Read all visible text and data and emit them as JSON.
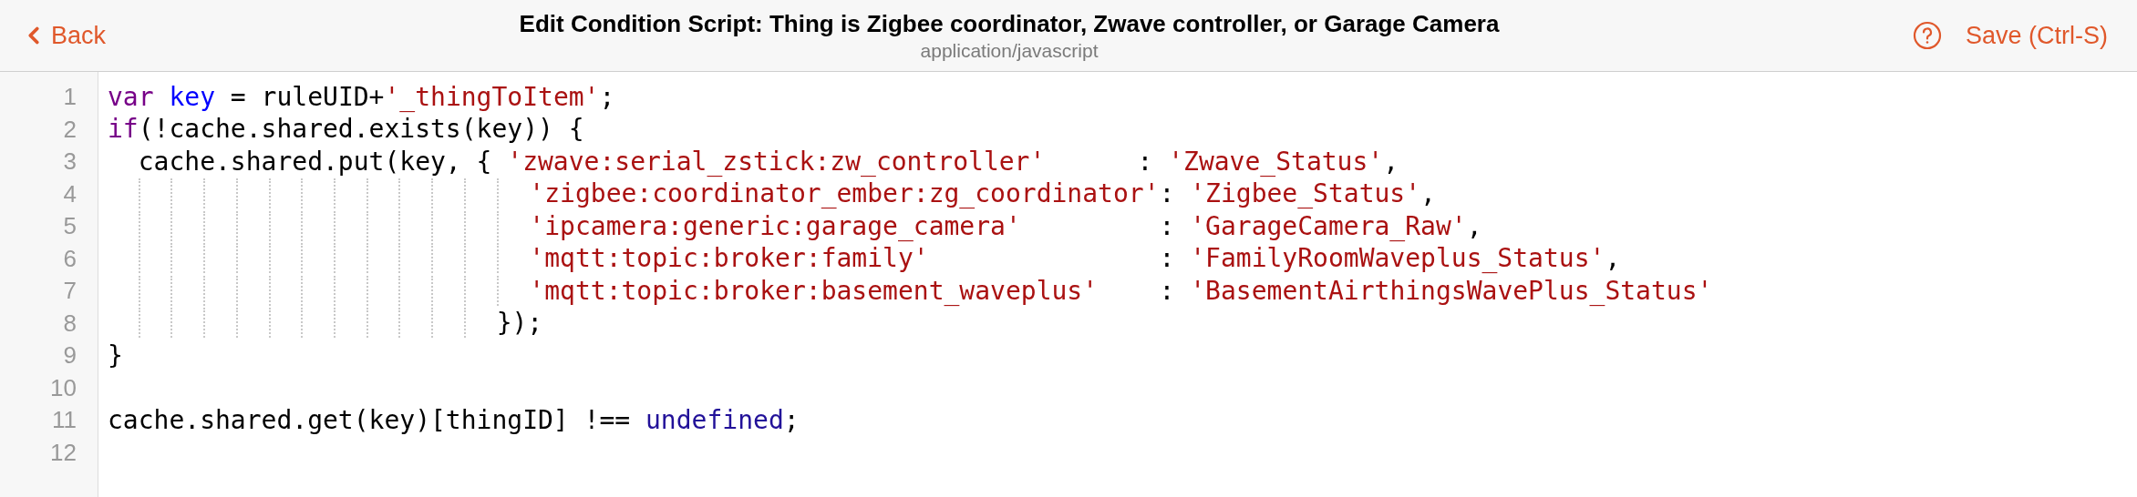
{
  "header": {
    "back": "Back",
    "title": "Edit Condition Script: Thing is Zigbee coordinator, Zwave controller, or Garage Camera",
    "subtitle": "application/javascript",
    "save": "Save (Ctrl-S)"
  },
  "editor": {
    "lines": [
      {
        "number": "1",
        "tokens": [
          {
            "kind": "keyword",
            "text": "var"
          },
          {
            "kind": "def",
            "text": " key"
          },
          {
            "kind": "plain",
            "text": " = ruleUID+"
          },
          {
            "kind": "string",
            "text": "'_thingToItem'"
          },
          {
            "kind": "plain",
            "text": ";"
          }
        ]
      },
      {
        "number": "2",
        "tokens": [
          {
            "kind": "keyword",
            "text": "if"
          },
          {
            "kind": "plain",
            "text": "(!cache.shared.exists(key)) {"
          }
        ]
      },
      {
        "number": "3",
        "tokens": [
          {
            "kind": "plain",
            "text": "  cache.shared.put(key, { "
          },
          {
            "kind": "string",
            "text": "'zwave:serial_zstick:zw_controller'"
          },
          {
            "kind": "plain",
            "text": "      : "
          },
          {
            "kind": "string",
            "text": "'Zwave_Status'"
          },
          {
            "kind": "plain",
            "text": ","
          }
        ]
      },
      {
        "number": "4",
        "tokens": [
          {
            "kind": "string",
            "text": "                          'zigbee:coordinator_ember:zg_coordinator'"
          },
          {
            "kind": "plain",
            "text": ": "
          },
          {
            "kind": "string",
            "text": "'Zigbee_Status'"
          },
          {
            "kind": "plain",
            "text": ","
          }
        ]
      },
      {
        "number": "5",
        "tokens": [
          {
            "kind": "string",
            "text": "                          'ipcamera:generic:garage_camera'"
          },
          {
            "kind": "plain",
            "text": "         : "
          },
          {
            "kind": "string",
            "text": "'GarageCamera_Raw'"
          },
          {
            "kind": "plain",
            "text": ","
          }
        ]
      },
      {
        "number": "6",
        "tokens": [
          {
            "kind": "string",
            "text": "                          'mqtt:topic:broker:family'"
          },
          {
            "kind": "plain",
            "text": "               : "
          },
          {
            "kind": "string",
            "text": "'FamilyRoomWaveplus_Status'"
          },
          {
            "kind": "plain",
            "text": ","
          }
        ]
      },
      {
        "number": "7",
        "tokens": [
          {
            "kind": "string",
            "text": "                          'mqtt:topic:broker:basement_waveplus'"
          },
          {
            "kind": "plain",
            "text": "    : "
          },
          {
            "kind": "string",
            "text": "'BasementAirthingsWavePlus_Status'"
          }
        ]
      },
      {
        "number": "8",
        "tokens": [
          {
            "kind": "plain",
            "text": "                        });"
          }
        ]
      },
      {
        "number": "9",
        "tokens": [
          {
            "kind": "plain",
            "text": "}"
          }
        ]
      },
      {
        "number": "10"
      },
      {
        "number": "11",
        "tokens": [
          {
            "kind": "plain",
            "text": "cache.shared.get(key)[thingID] !== "
          },
          {
            "kind": "atom",
            "text": "undefined"
          },
          {
            "kind": "plain",
            "text": ";"
          }
        ]
      },
      {
        "number": "12"
      }
    ]
  }
}
